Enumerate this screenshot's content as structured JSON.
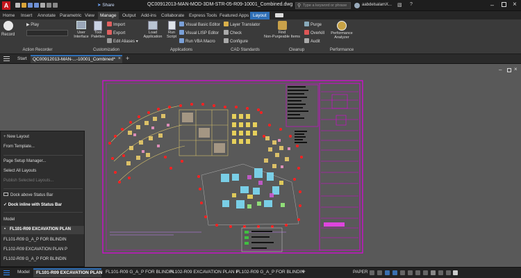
{
  "titlebar": {
    "file_title": "QC00912013-MAN-MOD-3DM-STR-05-R09-10001_Combined.dwg",
    "share_label": "Share",
    "search_placeholder": "Type a keyword or phrase",
    "user_name": "aabdelsalamX..."
  },
  "ribbon_tabs": [
    "Home",
    "Insert",
    "Annotate",
    "Parametric",
    "View",
    "Manage",
    "Output",
    "Add-ins",
    "Collaborate",
    "Express Tools",
    "Featured Apps",
    "Layout"
  ],
  "ribbon": {
    "action_recorder": {
      "record_label": "Record",
      "play_label": "Play",
      "panel_label": "Action Recorder"
    },
    "customization": {
      "user_interface_label": "User Interface",
      "user_interface_label_l1": "User",
      "user_interface_label_l2": "Interface",
      "tool_palettes_label": "Tool Palettes",
      "tool_palettes_label_l1": "Tool",
      "tool_palettes_label_l2": "Palettes",
      "import_label": "Import",
      "export_label": "Export",
      "edit_aliases_label": "Edit Aliases",
      "panel_label": "Customization"
    },
    "applications": {
      "load_application_label": "Load Application",
      "load_application_label_l1": "Load",
      "load_application_label_l2": "Application",
      "run_script_label": "Run Script",
      "run_script_label_l1": "Run",
      "run_script_label_l2": "Script",
      "vb_editor_label": "Visual Basic Editor",
      "lisp_editor_label": "Visual LISP Editor",
      "run_vba_label": "Run VBA Macro",
      "panel_label": "Applications"
    },
    "cad_standards": {
      "layer_translator_label": "Layer Translator",
      "check_label": "Check",
      "configure_label": "Configure",
      "panel_label": "CAD Standards"
    },
    "cleanup": {
      "find_nonpurgeable_label": "Find Non-Purgeable Items",
      "find_nonpurgeable_label_l1": "Find",
      "find_nonpurgeable_label_l2": "Non-Purgeable Items",
      "purge_label": "Purge",
      "overkill_label": "Overkill",
      "audit_label": "Audit",
      "panel_label": "Cleanup"
    },
    "performance": {
      "analyzer_label": "Performance Analyzer",
      "analyzer_label_l1": "Performance",
      "analyzer_label_l2": "Analyzer",
      "panel_label": "Performance"
    }
  },
  "file_tabs": {
    "start_label": "Start",
    "drawing_label": "QC00912013-MAN-...-10001_Combined*"
  },
  "context_menu": {
    "new_layout": "New Layout",
    "from_template": "From Template...",
    "page_setup_manager": "Page Setup Manager...",
    "select_all_layouts": "Select All Layouts",
    "publish_selected": "Publish Selected Layouts...",
    "dock_above": "Dock above Status Bar",
    "dock_inline": "Dock inline with Status Bar",
    "layout_list": [
      "Model",
      "FL101-R09  EXCAVATION PLAN",
      "FL101-R09 G_A_P FOR BLINDIN",
      "FL102-R09 EXCAVATION PLAN P",
      "FL102-R09 G_A_P FOR BLINDIN"
    ]
  },
  "status_tabs": [
    "Model",
    "FL101-R09  EXCAVATION PLAN",
    "FL101-R09 G_A_P FOR BLINDIN",
    "FL102-R09 EXCAVATION PLAN P",
    "FL102-R09 G_A_P FOR BLINDIN"
  ],
  "status_mode": "PAPER",
  "colors": {
    "accent": "#2f6fb6",
    "magenta": "#e000e0",
    "red_marker": "#ff2020",
    "canvas": "#595959"
  }
}
